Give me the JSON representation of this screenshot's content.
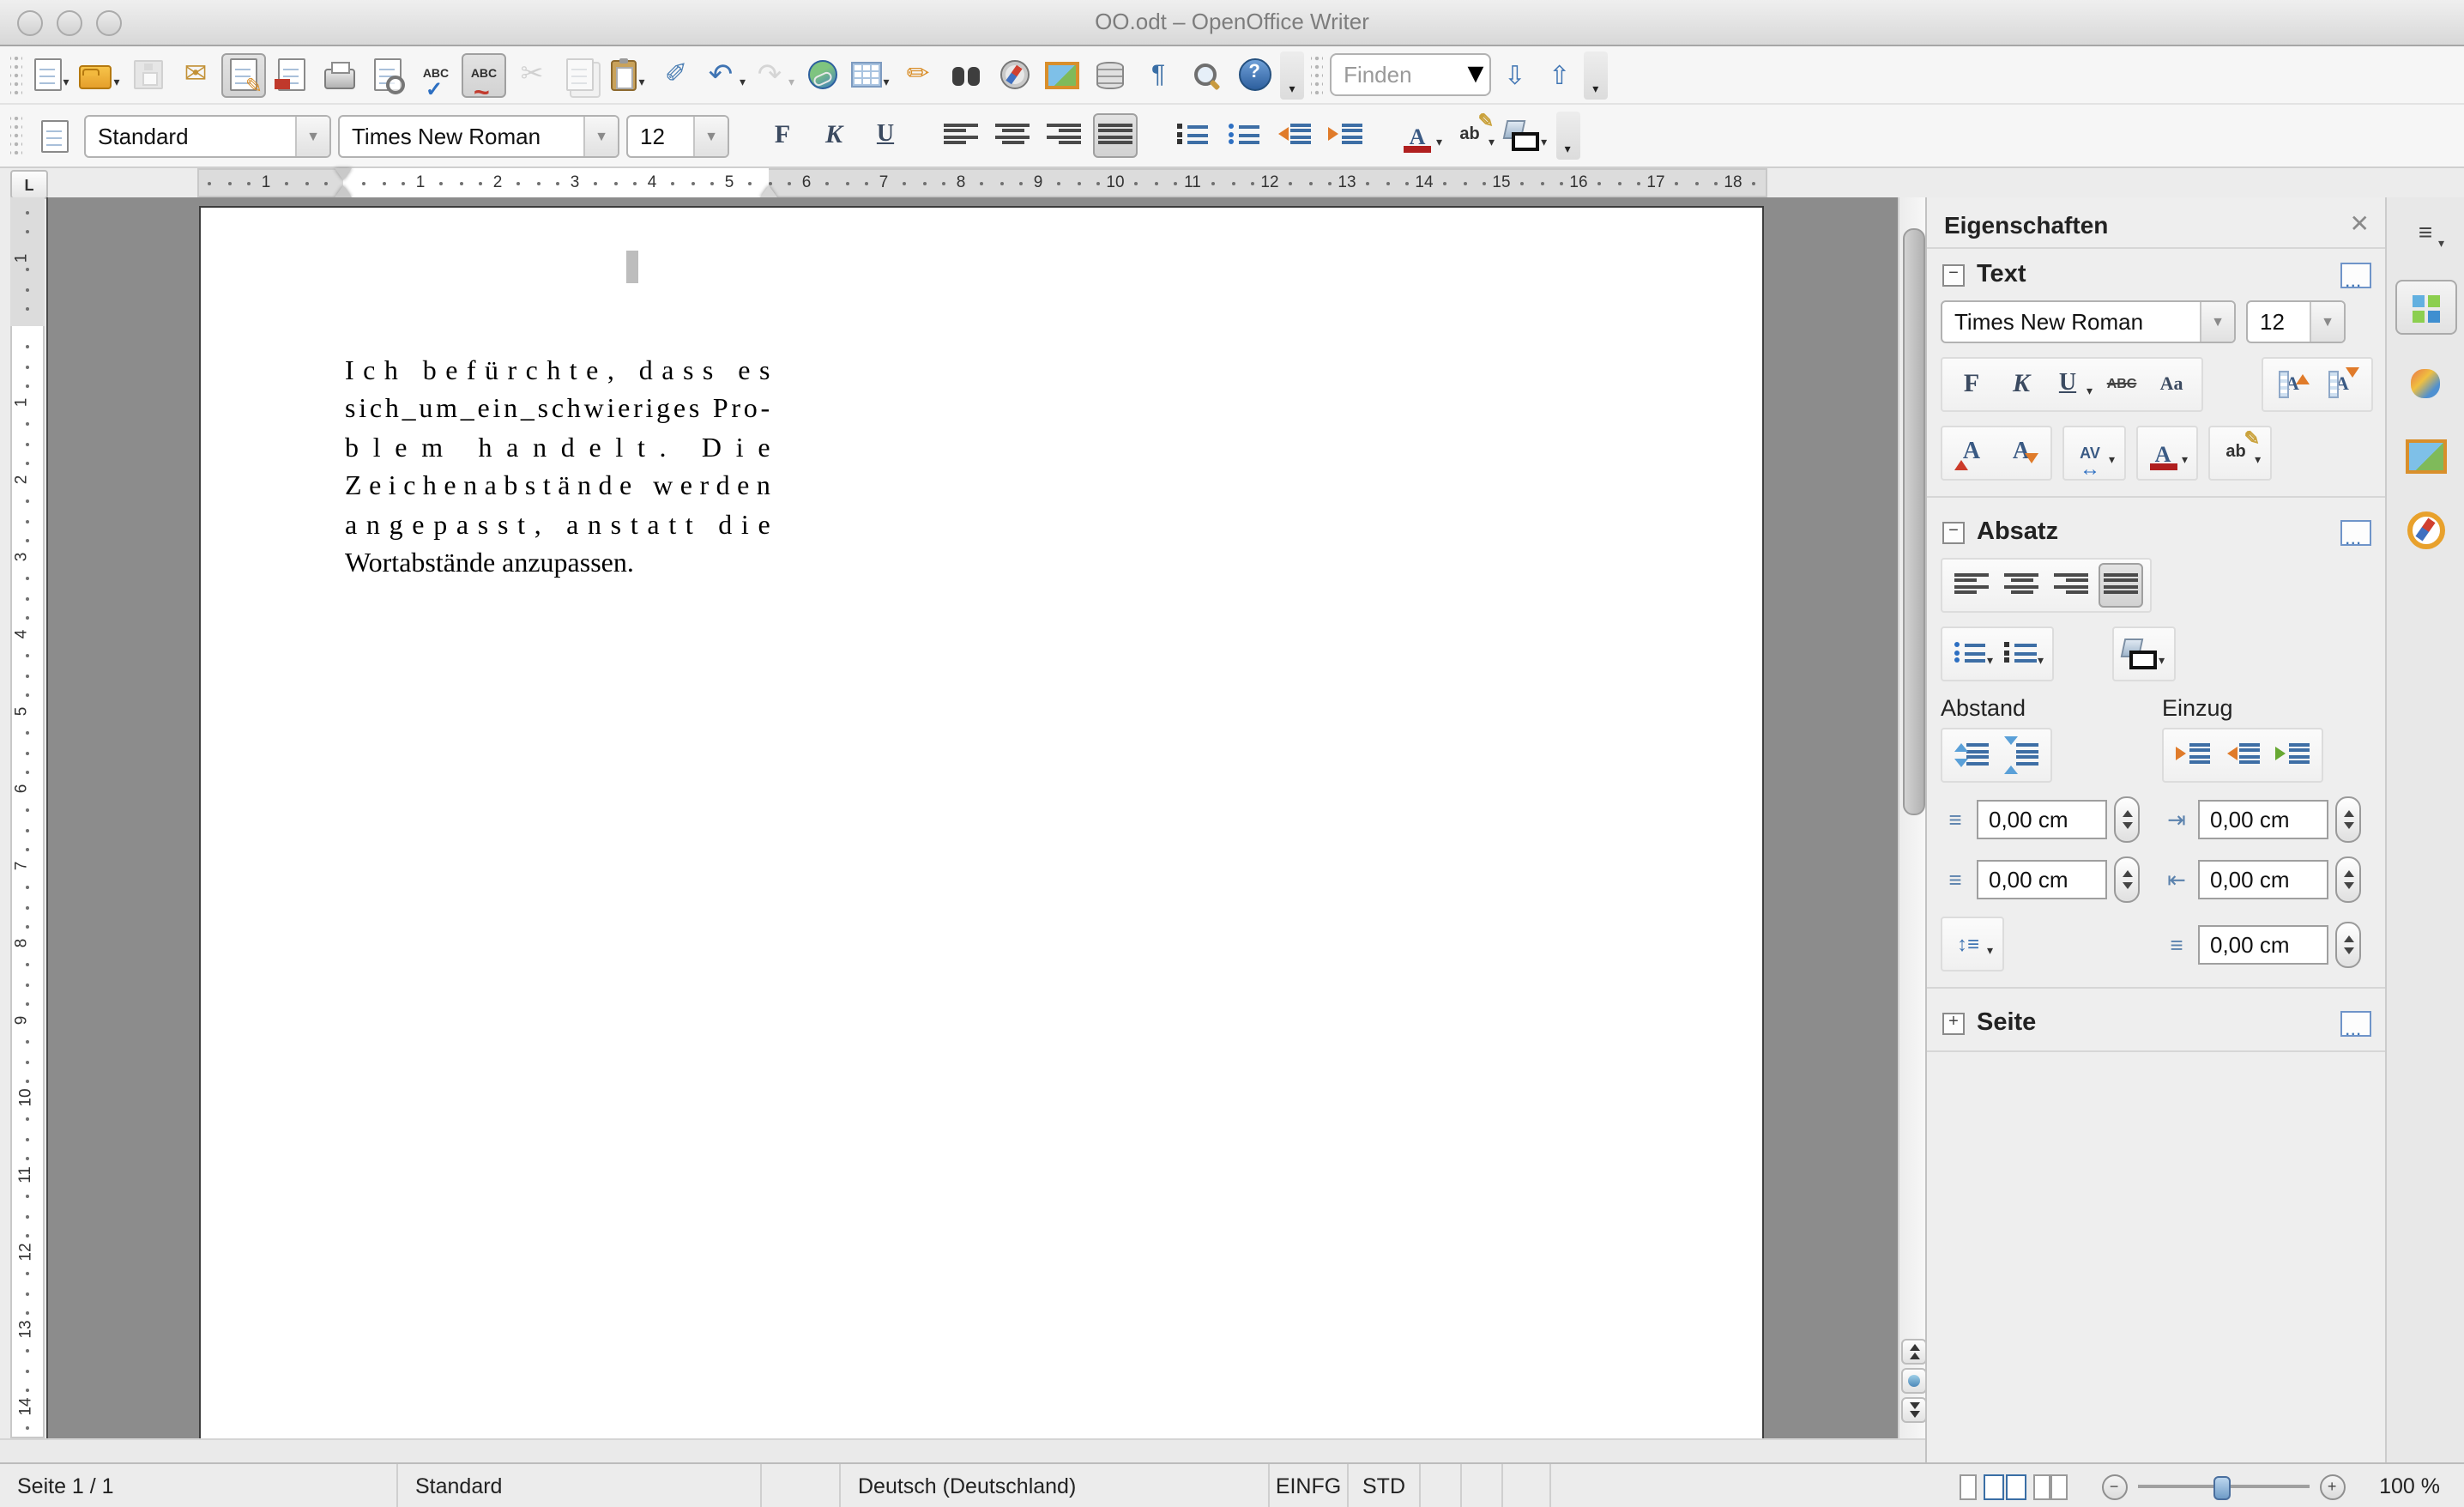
{
  "window": {
    "title": "OO.odt – OpenOffice Writer"
  },
  "toolbar_main": {
    "items": [
      {
        "sep": "handle"
      },
      {
        "n": "new-document",
        "cls": "pg",
        "dd": true
      },
      {
        "n": "open-document",
        "cls": "fold",
        "dd": true
      },
      {
        "n": "save",
        "cls": "disk",
        "dis": true
      },
      {
        "n": "email-document",
        "g": "✉",
        "c": "#c29136",
        "fs": 16
      },
      {
        "n": "edit-file",
        "cls": "pg pencil",
        "act": true
      },
      {
        "n": "export-pdf",
        "cls": "pg pdf"
      },
      {
        "n": "print",
        "cls": "printer"
      },
      {
        "n": "print-preview",
        "cls": "pg magnsm"
      },
      {
        "n": "spellcheck",
        "cls": "abc check",
        "g": "ABC"
      },
      {
        "n": "auto-spellcheck",
        "cls": "abc wave",
        "g": "ABC",
        "act": true
      },
      {
        "n": "cut",
        "g": "✂",
        "c": "#8a8a8a",
        "fs": 16,
        "dis": true
      },
      {
        "n": "copy",
        "cls": "pg copy",
        "dis": true
      },
      {
        "n": "paste",
        "cls": "clip",
        "dd": true
      },
      {
        "n": "format-paintbrush",
        "g": "✐",
        "c": "#4f81b5",
        "fs": 16
      },
      {
        "n": "undo",
        "g": "↶",
        "c": "#3f74b3",
        "fs": 17,
        "dd": true
      },
      {
        "n": "redo",
        "g": "↷",
        "c": "#9a9a9a",
        "fs": 17,
        "dd": true,
        "dis": true
      },
      {
        "n": "hyperlink",
        "cls": "globe"
      },
      {
        "n": "insert-table",
        "cls": "grid",
        "dd": true
      },
      {
        "n": "draw-functions",
        "g": "✏",
        "c": "#d98f2b",
        "fs": 16
      },
      {
        "n": "find-replace",
        "cls": "binoc"
      },
      {
        "n": "navigator",
        "cls": "compass"
      },
      {
        "n": "gallery",
        "cls": "photo"
      },
      {
        "n": "data-sources",
        "cls": "db"
      },
      {
        "n": "formatting-marks",
        "g": "¶",
        "c": "#3a6ea5",
        "fs": 15
      },
      {
        "n": "zoom",
        "cls": "magn"
      },
      {
        "n": "help",
        "cls": "help"
      },
      {
        "n": "main-toolbar",
        "ovf": true
      },
      {
        "sep": "handle"
      }
    ],
    "find": {
      "placeholder": "Finden",
      "next_glyph": "⇩",
      "prev_glyph": "⇧"
    }
  },
  "toolbar_format": {
    "style_value": "Standard",
    "font_value": "Times New Roman",
    "size_value": "12",
    "items": [
      {
        "n": "bold",
        "g": "F",
        "cls": "g serifb"
      },
      {
        "n": "italic",
        "g": "K",
        "cls": "g serifi"
      },
      {
        "n": "underline",
        "g": "U",
        "cls": "g serifu"
      },
      {
        "sep": "gap"
      },
      {
        "n": "align-left",
        "cls": "bars al-left",
        "nb": 4
      },
      {
        "n": "align-center",
        "cls": "bars al-center",
        "nb": 4
      },
      {
        "n": "align-right",
        "cls": "bars al-right",
        "nb": 4
      },
      {
        "n": "align-justify",
        "cls": "bars al-just",
        "nb": 4,
        "act": true
      },
      {
        "sep": "gap"
      },
      {
        "n": "numbered-list",
        "cls": "list numlist",
        "nb": 3
      },
      {
        "n": "bullet-list",
        "cls": "list bullist",
        "nb": 3
      },
      {
        "n": "decrease-indent",
        "cls": "ind dec",
        "nb": 4
      },
      {
        "n": "increase-indent",
        "cls": "ind inc",
        "nb": 4
      },
      {
        "sep": "gap"
      },
      {
        "n": "font-color",
        "g": "A",
        "cls": "fontA",
        "dd": true
      },
      {
        "n": "highlight-color",
        "g": "ab",
        "cls": "hl",
        "dd": true
      },
      {
        "n": "background-color",
        "cls": "can",
        "dd": true
      },
      {
        "n": "format-toolbar",
        "ovf": true
      }
    ]
  },
  "ruler": {
    "tab_selector_label": "L",
    "h_margin_label": "1",
    "h_numbers": [
      "1",
      "2",
      "3",
      "4",
      "5",
      "6",
      "7",
      "8",
      "9",
      "10",
      "11",
      "12",
      "13",
      "14",
      "15",
      "16",
      "17",
      "18"
    ],
    "v_margin_label": "1",
    "v_numbers": [
      "1",
      "2",
      "3",
      "4",
      "5",
      "6",
      "7",
      "8",
      "9",
      "10",
      "11",
      "12",
      "13",
      "14"
    ]
  },
  "document": {
    "lines": [
      {
        "text": "Ich befürchte, dass es",
        "justified": true
      },
      {
        "text": "sich_um_ein_schwieriges Pro-",
        "justified": true
      },
      {
        "text": "blem handelt. Die",
        "justified": true
      },
      {
        "text": "Zeichenabstände werden",
        "justified": true
      },
      {
        "text": "angepasst, anstatt die",
        "justified": true
      },
      {
        "text": "Wortabstände anzupassen.",
        "justified": false
      }
    ]
  },
  "sidebar": {
    "title": "Eigenschaften",
    "close_glyph": "✕",
    "text_section": {
      "label": "Text",
      "font_value": "Times New Roman",
      "size_value": "12",
      "row1a": [
        {
          "n": "bold",
          "g": "F",
          "cls": "g serifb"
        },
        {
          "n": "italic",
          "g": "K",
          "cls": "g serifi"
        },
        {
          "n": "underline",
          "g": "U",
          "cls": "g serifu",
          "dd": true
        },
        {
          "n": "strikethrough",
          "g": "ABC",
          "cls": "g strike"
        },
        {
          "n": "toggle-case",
          "g": "Aa",
          "cls": "g serifb",
          "fs": 11
        }
      ],
      "row1b": [
        {
          "n": "superscript",
          "g": "A",
          "cls": "posA up"
        },
        {
          "n": "subscript",
          "g": "A",
          "cls": "posA dn"
        }
      ],
      "row2a": [
        {
          "n": "increase-font-size",
          "g": "A",
          "cls": "sizeA up"
        },
        {
          "n": "decrease-font-size",
          "g": "A",
          "cls": "sizeA dn"
        }
      ],
      "row2b": [
        {
          "n": "character-spacing",
          "g": "AV",
          "cls": "avspace",
          "dd": true
        }
      ],
      "row2c": [
        {
          "n": "font-color",
          "g": "A",
          "cls": "fontA",
          "dd": true
        }
      ],
      "row2d": [
        {
          "n": "highlight-color",
          "g": "ab",
          "cls": "hl",
          "dd": true
        }
      ]
    },
    "paragraph_section": {
      "label": "Absatz",
      "align": [
        {
          "n": "align-left",
          "cls": "bars al-left",
          "nb": 4
        },
        {
          "n": "align-center",
          "cls": "bars al-center",
          "nb": 4
        },
        {
          "n": "align-right",
          "cls": "bars al-right",
          "nb": 4
        },
        {
          "n": "align-justify",
          "cls": "bars al-just",
          "nb": 4,
          "act": true
        }
      ],
      "lists": [
        {
          "n": "bullet-list",
          "cls": "list bullist",
          "nb": 3,
          "dd": true
        },
        {
          "n": "numbered-list",
          "cls": "list numlist",
          "nb": 3,
          "dd": true
        }
      ],
      "background": [
        {
          "n": "paragraph-background",
          "cls": "can",
          "dd": true
        }
      ],
      "spacing_label": "Abstand",
      "indent_label": "Einzug",
      "spacing_buttons": [
        {
          "n": "increase-spacing",
          "cls": "spc up",
          "nb": 4
        },
        {
          "n": "decrease-spacing",
          "cls": "spc dn",
          "nb": 4
        }
      ],
      "indent_buttons": [
        {
          "n": "increase-indent",
          "cls": "ind inc",
          "nb": 4
        },
        {
          "n": "decrease-indent",
          "cls": "ind dec",
          "nb": 4
        },
        {
          "n": "hanging-indent",
          "cls": "ind hang",
          "nb": 4
        }
      ],
      "line_spacing": [
        {
          "n": "line-spacing",
          "g": "↕≡",
          "c": "#3f74b3",
          "fs": 12,
          "dd": true
        }
      ],
      "fields": {
        "above": "0,00 cm",
        "below": "0,00 cm",
        "before": "0,00 cm",
        "after": "0,00 cm",
        "first_line": "0,00 cm"
      }
    },
    "page_section": {
      "label": "Seite"
    }
  },
  "statusbar": {
    "page": "Seite 1 / 1",
    "style": "Standard",
    "language": "Deutsch (Deutschland)",
    "insert_mode": "EINFG",
    "selection_mode": "STD",
    "zoom": "100 %"
  },
  "colors": {
    "accent_blue": "#3a6ea5",
    "highlight_yellow": "#ffe400",
    "font_color_red": "#b01f1f",
    "canvas_gray": "#8c8c8c"
  }
}
